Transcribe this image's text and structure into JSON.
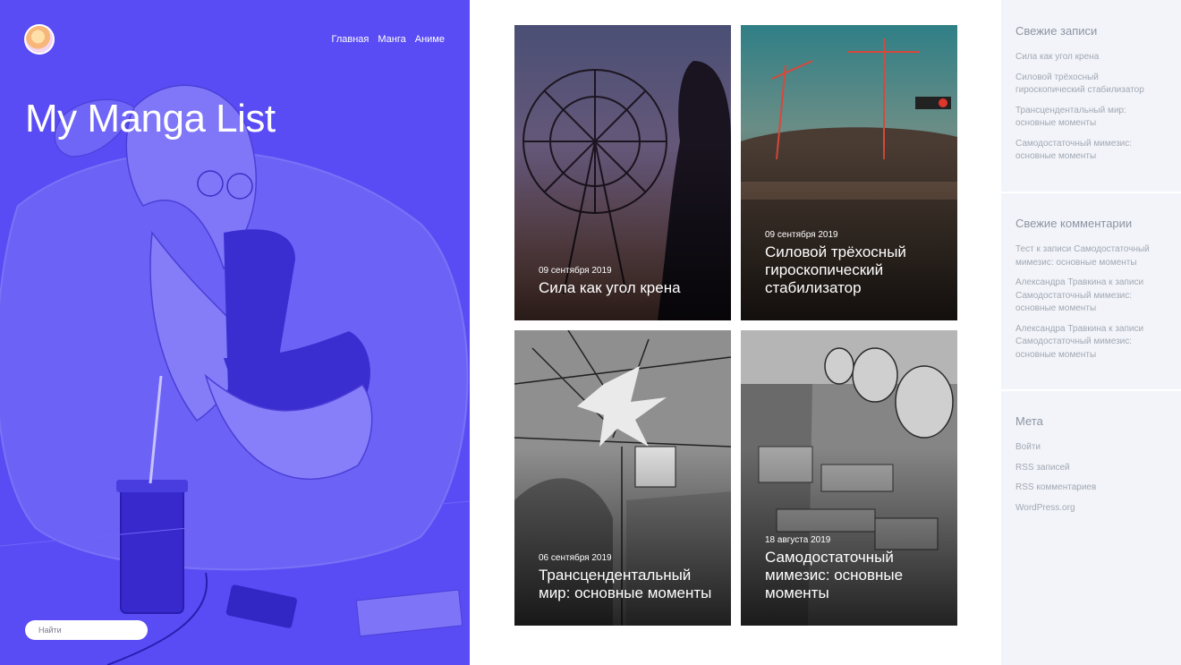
{
  "site": {
    "title": "My Manga List"
  },
  "nav": {
    "items": [
      "Главная",
      "Манга",
      "Аниме"
    ]
  },
  "search": {
    "placeholder": "Найти"
  },
  "posts": [
    {
      "date": "09 сентября 2019",
      "title": "Сила как угол крена",
      "image": "ferris-wheel-silhouette"
    },
    {
      "date": "09 сентября 2019",
      "title": "Силовой трёхосный гироскопический стабилизатор",
      "image": "stadium-construction"
    },
    {
      "date": "06 сентября 2019",
      "title": "Трансцендентальный мир: основные моменты",
      "image": "manga-panel-punch"
    },
    {
      "date": "18 августа 2019",
      "title": "Самодостаточный мимезис: основные моменты",
      "image": "manga-panel-city"
    }
  ],
  "sidebar": {
    "recent_posts": {
      "heading": "Свежие записи",
      "items": [
        "Сила как угол крена",
        "Силовой трёхосный гироскопический стабилизатор",
        "Трансцендентальный мир: основные моменты",
        "Самодостаточный мимезис: основные моменты"
      ]
    },
    "recent_comments": {
      "heading": "Свежие комментарии",
      "items": [
        "Тест к записи Самодостаточный мимезис: основные моменты",
        "Александра Травкина к записи Самодостаточный мимезис: основные моменты",
        "Александра Травкина к записи Самодостаточный мимезис: основные моменты"
      ]
    },
    "meta": {
      "heading": "Мета",
      "items": [
        "Войти",
        "RSS записей",
        "RSS комментариев",
        "WordPress.org"
      ]
    }
  },
  "colors": {
    "hero": "#5a4cf5",
    "sidebar_bg": "#f2f4f9",
    "sidebar_text": "#a2a8b4"
  }
}
